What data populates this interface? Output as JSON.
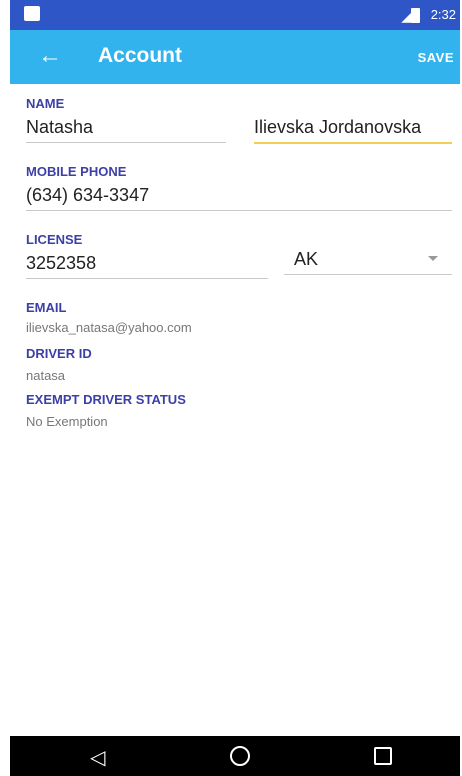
{
  "status_bar": {
    "time": "2:32"
  },
  "app_bar": {
    "title": "Account",
    "save_label": "SAVE"
  },
  "name": {
    "label": "NAME",
    "first": "Natasha",
    "last": "Ilievska Jordanovska"
  },
  "mobile": {
    "label": "MOBILE PHONE",
    "value": "(634) 634-3347"
  },
  "license": {
    "label": "LICENSE",
    "number": "3252358",
    "state": "AK"
  },
  "email": {
    "label": "EMAIL",
    "value": "ilievska_natasa@yahoo.com"
  },
  "driver_id": {
    "label": "DRIVER ID",
    "value": "natasa"
  },
  "exempt": {
    "label": "EXEMPT DRIVER STATUS",
    "value": "No Exemption"
  }
}
